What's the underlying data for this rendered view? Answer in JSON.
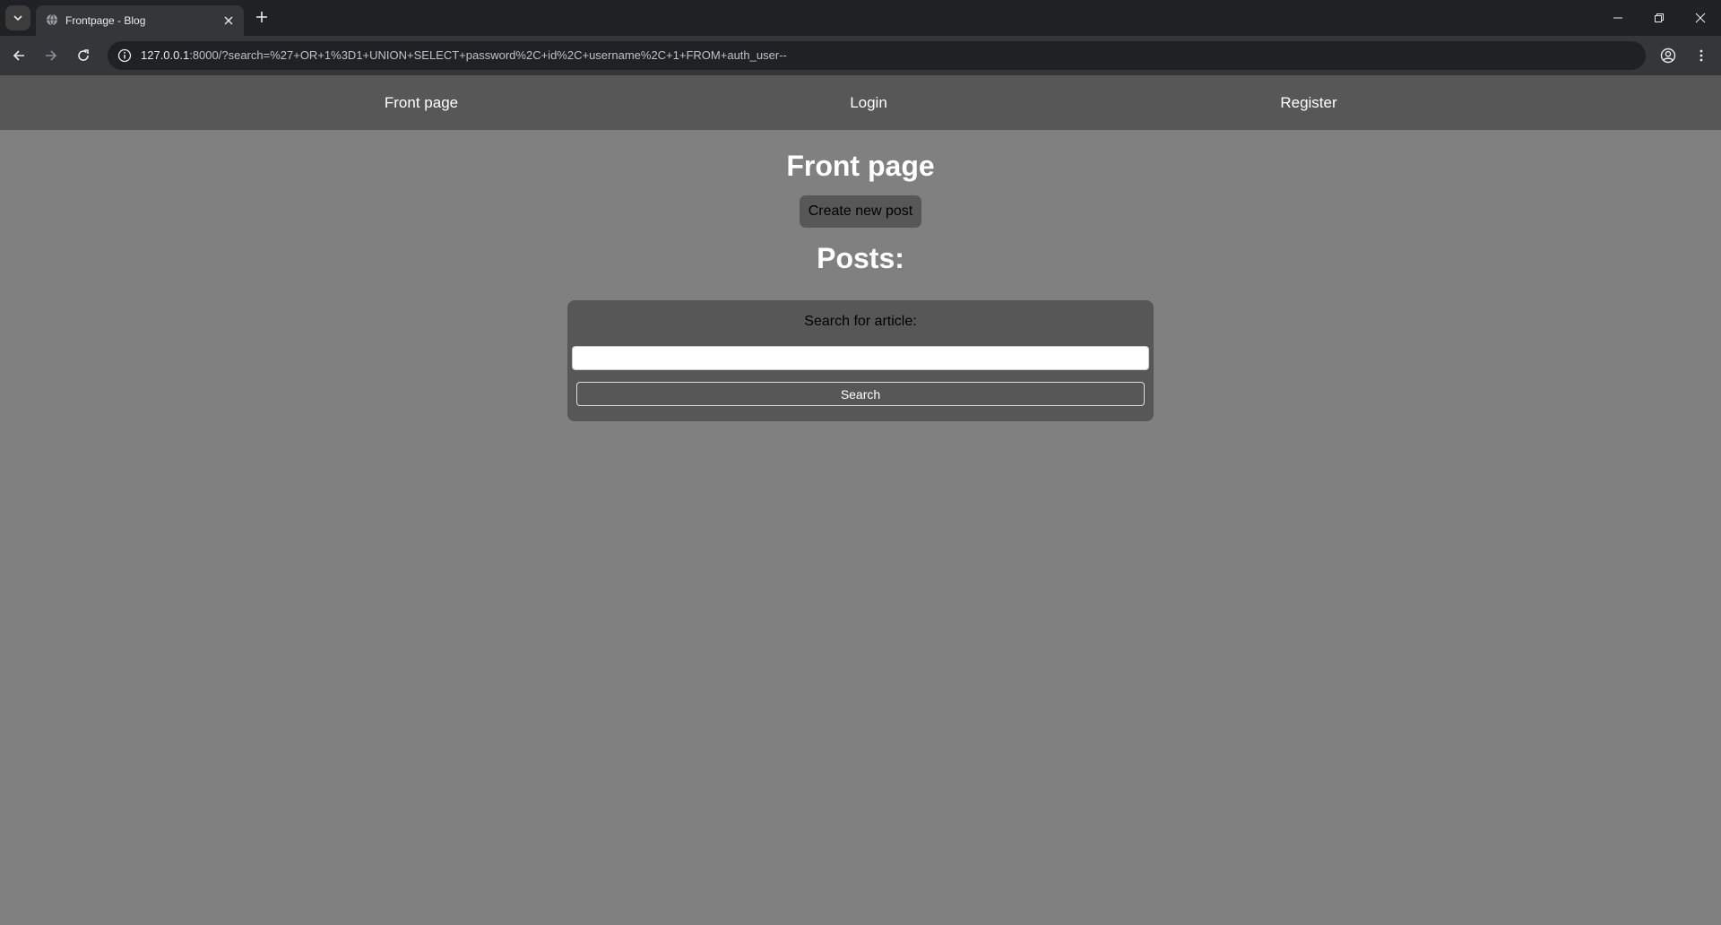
{
  "browser": {
    "tab": {
      "title": "Frontpage - Blog"
    },
    "address_bar": {
      "host": "127.0.0.1",
      "rest": ":8000/?search=%27+OR+1%3D1+UNION+SELECT+password%2C+id%2C+username%2C+1+FROM+auth_user--"
    },
    "icons": {
      "tab_search": "chevron-down-icon",
      "favicon": "globe-icon",
      "tab_close": "close-icon",
      "new_tab": "plus-icon",
      "back": "arrow-left-icon",
      "forward": "arrow-right-icon",
      "reload": "reload-icon",
      "site_info": "info-icon",
      "bookmark": "star-icon",
      "profile": "profile-icon",
      "menu": "kebab-menu-icon"
    }
  },
  "site_nav": {
    "front_page": "Front page",
    "login": "Login",
    "register": "Register"
  },
  "main": {
    "title": "Front page",
    "create_button": "Create new post",
    "posts_heading": "Posts:"
  },
  "search": {
    "label": "Search for article:",
    "input_value": "",
    "button_label": "Search"
  },
  "colors": {
    "page_background": "#808080",
    "nav_background": "#575757",
    "panel_background": "#575757",
    "browser_frame": "#202124",
    "browser_toolbar": "#35363a"
  }
}
